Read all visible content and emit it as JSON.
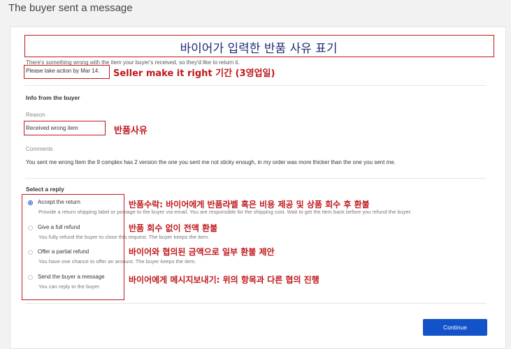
{
  "header": {
    "title": "The buyer sent a message"
  },
  "message": {
    "intro": "There's something wrong with the item your buyer's received, so they'd like to return it.",
    "deadline": "Please take action by Mar 14."
  },
  "buyer_info": {
    "title": "Info from the buyer",
    "reason_label": "Reason",
    "reason_value": "Received wrong item",
    "comments_label": "Comments",
    "comments_value": "You sent me wrong Item the 9 complex has 2 version the one you sent me not sticky enough, in my order was more thicker than the one you sent me."
  },
  "reply": {
    "title": "Select a reply",
    "options": [
      {
        "label": "Accept the return",
        "desc": "Provide a return shipping label or postage to the buyer via email. You are responsible for the shipping cost. Wait to get the item back before you refund the buyer.",
        "selected": true
      },
      {
        "label": "Give a full refund",
        "desc": "You fully refund the buyer to close this request. The buyer keeps the item.",
        "selected": false
      },
      {
        "label": "Offer a partial refund",
        "desc": "You have one chance to offer an amount. The buyer keeps the item.",
        "selected": false
      },
      {
        "label": "Send the buyer a message",
        "desc": "You can reply to the buyer.",
        "selected": false
      }
    ],
    "continue_label": "Continue"
  },
  "annotations": {
    "title_note": "바이어가 입력한 반품 사유 표기",
    "deadline_note": "Seller make it right 기간 (3영업일)",
    "reason_note": "반품사유",
    "opt1_note": "반품수락: 바이어에게 반품라벨 혹은 비용 제공 및 상품 회수 후 환불",
    "opt2_note": "반품 회수 없이 전액 환불",
    "opt3_note": "바이어와 협의된 금액으로 일부 환불 제안",
    "opt4_note": "바이어에게 메시지보내기: 위의 항목과 다른 협의 진행"
  }
}
